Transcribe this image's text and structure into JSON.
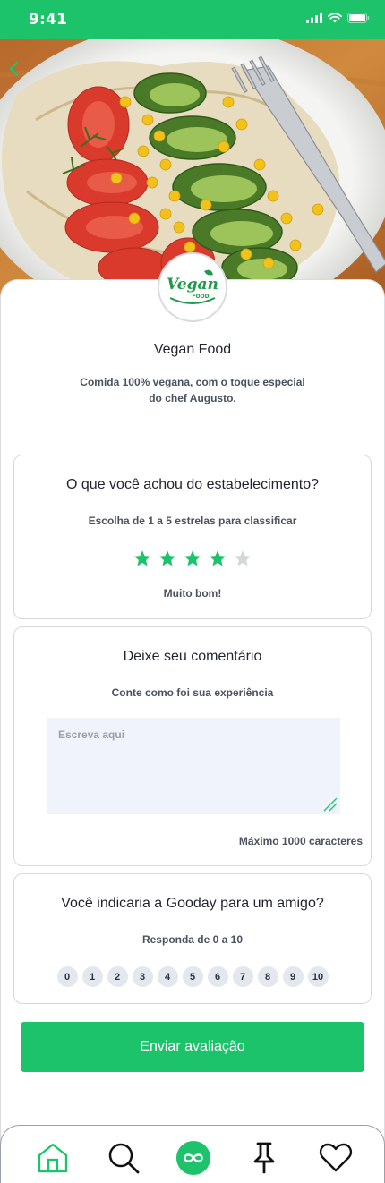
{
  "status_bar": {
    "time": "9:41"
  },
  "restaurant": {
    "name": "Vegan Food",
    "description_line1": "Comida 100% vegana, com o toque especial",
    "description_line2": "do chef Augusto.",
    "logo_text": "Vegan",
    "logo_subtext": "FOOD"
  },
  "rating_card": {
    "title": "O que você achou do estabelecimento?",
    "subtitle": "Escolha de 1 a 5 estrelas para classificar",
    "rating": 4,
    "max_rating": 5,
    "rating_label": "Muito bom!"
  },
  "comment_card": {
    "title": "Deixe seu comentário",
    "subtitle": "Conte como foi sua experiência",
    "placeholder": "Escreva aqui",
    "value": "",
    "max_label": "Máximo 1000 caracteres"
  },
  "nps_card": {
    "title": "Você indicaria a Gooday para um amigo?",
    "subtitle": "Responda de 0 a 10",
    "options": [
      "0",
      "1",
      "2",
      "3",
      "4",
      "5",
      "6",
      "7",
      "8",
      "9",
      "10"
    ]
  },
  "submit_label": "Enviar avaliação",
  "tab_bar": {
    "tabs": [
      {
        "icon": "home-icon"
      },
      {
        "icon": "search-icon"
      },
      {
        "icon": "infinity-icon",
        "active": true
      },
      {
        "icon": "pin-icon"
      },
      {
        "icon": "heart-icon"
      }
    ]
  },
  "colors": {
    "accent": "#1cc36a",
    "star_off": "#d3d6da",
    "field_bg": "#f0f3fb"
  }
}
